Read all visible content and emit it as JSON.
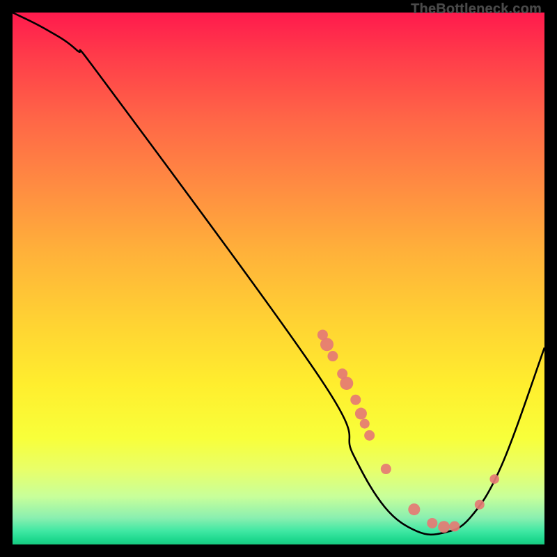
{
  "watermark": "TheBottleneck.com",
  "chart_data": {
    "type": "line",
    "title": "",
    "xlabel": "",
    "ylabel": "",
    "xlim": [
      0,
      100
    ],
    "ylim": [
      0,
      100
    ],
    "curve": [
      {
        "x": 0,
        "y": 100
      },
      {
        "x": 6,
        "y": 97
      },
      {
        "x": 12,
        "y": 93
      },
      {
        "x": 18,
        "y": 86
      },
      {
        "x": 58,
        "y": 31
      },
      {
        "x": 64,
        "y": 17
      },
      {
        "x": 70,
        "y": 7
      },
      {
        "x": 76,
        "y": 2.5
      },
      {
        "x": 81,
        "y": 2.2
      },
      {
        "x": 86,
        "y": 5
      },
      {
        "x": 92,
        "y": 15
      },
      {
        "x": 100,
        "y": 37
      }
    ],
    "markers": [
      {
        "x": 58.3,
        "y": 39.4,
        "r": 7.5
      },
      {
        "x": 59.1,
        "y": 37.6,
        "r": 9.5
      },
      {
        "x": 60.2,
        "y": 35.4,
        "r": 7.5
      },
      {
        "x": 62.0,
        "y": 32.1,
        "r": 7.5
      },
      {
        "x": 62.8,
        "y": 30.3,
        "r": 9.5
      },
      {
        "x": 64.5,
        "y": 27.2,
        "r": 7.5
      },
      {
        "x": 65.5,
        "y": 24.6,
        "r": 8.5
      },
      {
        "x": 66.2,
        "y": 22.7,
        "r": 7.0
      },
      {
        "x": 67.1,
        "y": 20.5,
        "r": 7.5
      },
      {
        "x": 70.2,
        "y": 14.2,
        "r": 7.5
      },
      {
        "x": 75.5,
        "y": 6.6,
        "r": 8.5
      },
      {
        "x": 78.9,
        "y": 4.0,
        "r": 7.5
      },
      {
        "x": 81.1,
        "y": 3.3,
        "r": 8.5
      },
      {
        "x": 83.1,
        "y": 3.4,
        "r": 7.5
      },
      {
        "x": 87.8,
        "y": 7.5,
        "r": 7.0
      },
      {
        "x": 90.6,
        "y": 12.3,
        "r": 6.8
      }
    ],
    "marker_color": "#e57a74",
    "curve_color": "#000000"
  }
}
